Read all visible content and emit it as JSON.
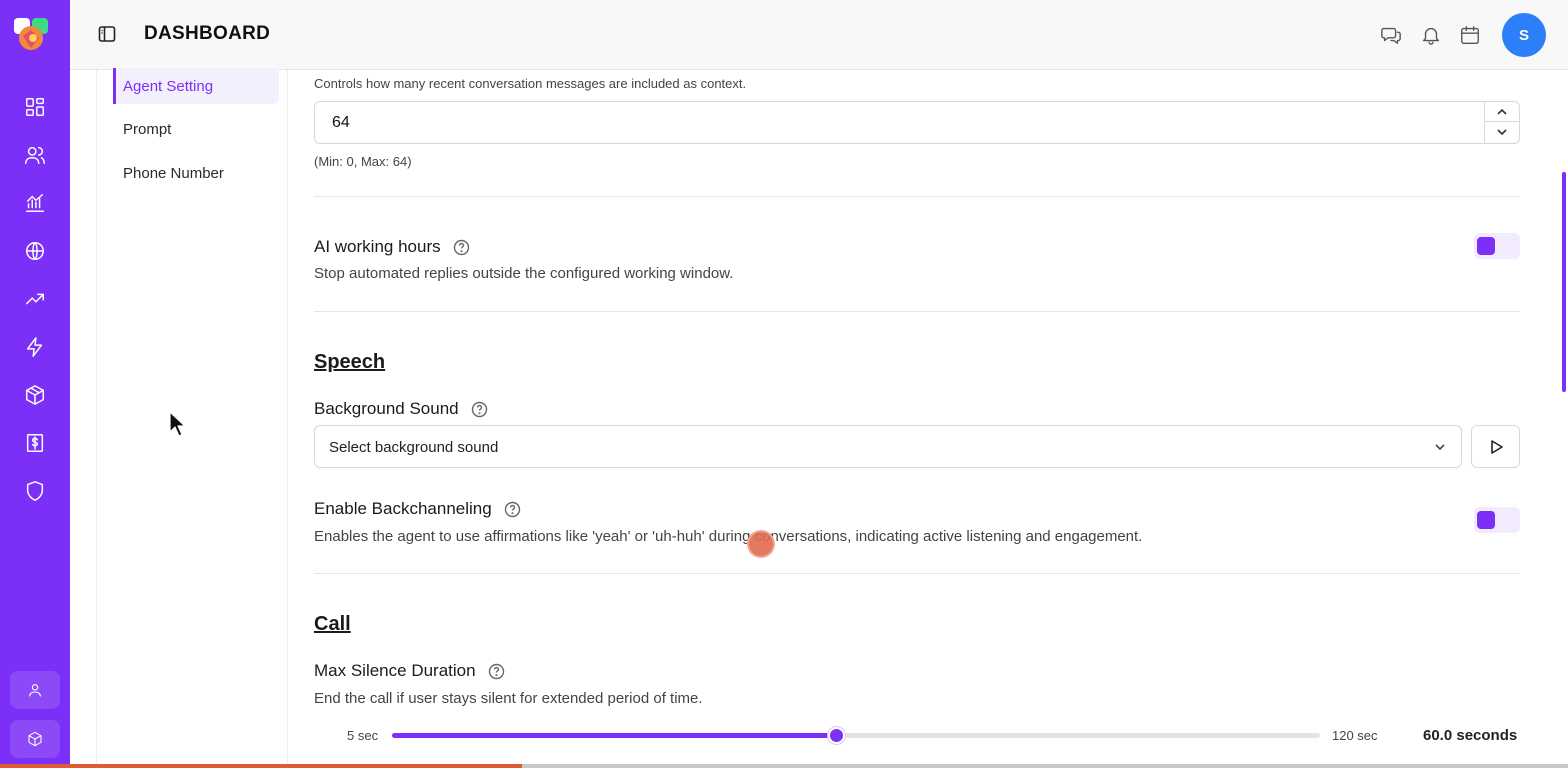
{
  "header": {
    "title": "DASHBOARD",
    "avatar_initial": "S",
    "icons": [
      "chat-icon",
      "bell-icon",
      "calendar-icon"
    ]
  },
  "rail": {
    "icons": [
      "dashboard-icon",
      "users-icon",
      "analytics-icon",
      "globe-icon",
      "trending-icon",
      "lightning-icon",
      "package-icon",
      "billing-icon",
      "shield-icon"
    ],
    "bottom": [
      "user-icon",
      "cube-icon"
    ]
  },
  "subnav": {
    "items": [
      {
        "label": "Agent Setting",
        "active": true
      },
      {
        "label": "Prompt",
        "active": false
      },
      {
        "label": "Phone Number",
        "active": false
      }
    ]
  },
  "context": {
    "description": "Controls how many recent conversation messages are included as context.",
    "value": "64",
    "hint": "(Min: 0, Max: 64)"
  },
  "working_hours": {
    "label": "AI working hours",
    "description": "Stop automated replies outside the configured working window.",
    "enabled": true
  },
  "speech": {
    "section_title": "Speech",
    "background_sound": {
      "label": "Background Sound",
      "selected": "Select background sound"
    },
    "backchanneling": {
      "label": "Enable Backchanneling",
      "description": "Enables the agent to use affirmations like 'yeah' or 'uh-huh' during conversations, indicating active listening and engagement.",
      "enabled": true
    }
  },
  "call": {
    "section_title": "Call",
    "max_silence": {
      "label": "Max Silence Duration",
      "description": "End the call if user stays silent for extended period of time.",
      "min_label": "5 sec",
      "max_label": "120 sec",
      "min": 5,
      "max": 120,
      "value": 60,
      "value_label": "60.0 seconds"
    }
  },
  "colors": {
    "accent": "#7b2ff7",
    "avatar": "#2d7ff9"
  },
  "progress": {
    "fraction": 0.333
  }
}
